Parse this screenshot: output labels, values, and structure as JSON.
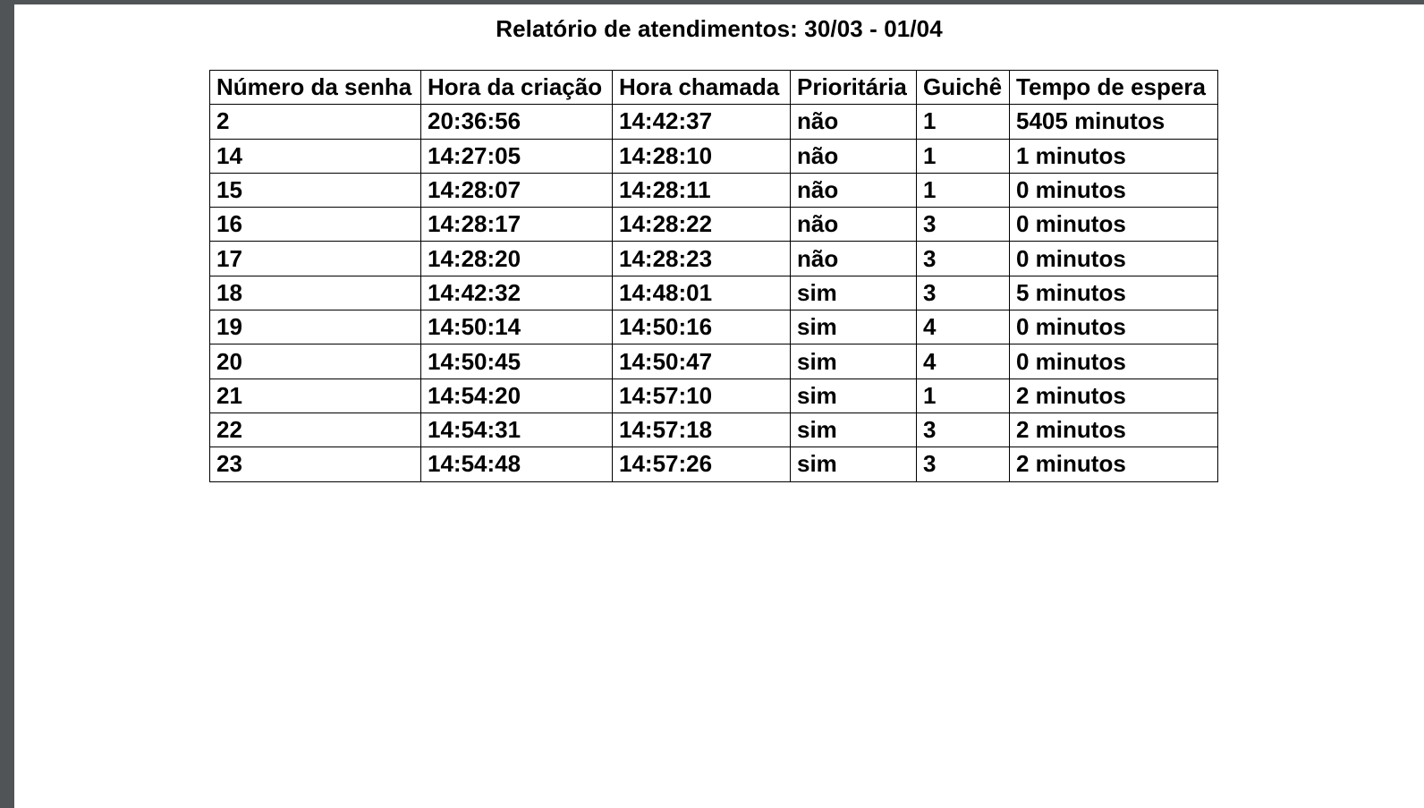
{
  "report": {
    "title": "Relatório de atendimentos: 30/03 - 01/04",
    "columns": [
      "Número da senha",
      "Hora da criação",
      "Hora chamada",
      "Prioritária",
      "Guichê",
      "Tempo de espera"
    ],
    "rows": [
      [
        "2",
        "20:36:56",
        "14:42:37",
        "não",
        "1",
        "5405 minutos"
      ],
      [
        "14",
        "14:27:05",
        "14:28:10",
        "não",
        "1",
        "1 minutos"
      ],
      [
        "15",
        "14:28:07",
        "14:28:11",
        "não",
        "1",
        "0 minutos"
      ],
      [
        "16",
        "14:28:17",
        "14:28:22",
        "não",
        "3",
        "0 minutos"
      ],
      [
        "17",
        "14:28:20",
        "14:28:23",
        "não",
        "3",
        "0 minutos"
      ],
      [
        "18",
        "14:42:32",
        "14:48:01",
        "sim",
        "3",
        "5 minutos"
      ],
      [
        "19",
        "14:50:14",
        "14:50:16",
        "sim",
        "4",
        "0 minutos"
      ],
      [
        "20",
        "14:50:45",
        "14:50:47",
        "sim",
        "4",
        "0 minutos"
      ],
      [
        "21",
        "14:54:20",
        "14:57:10",
        "sim",
        "1",
        "2 minutos"
      ],
      [
        "22",
        "14:54:31",
        "14:57:18",
        "sim",
        "3",
        "2 minutos"
      ],
      [
        "23",
        "14:54:48",
        "14:57:26",
        "sim",
        "3",
        "2 minutos"
      ]
    ]
  }
}
